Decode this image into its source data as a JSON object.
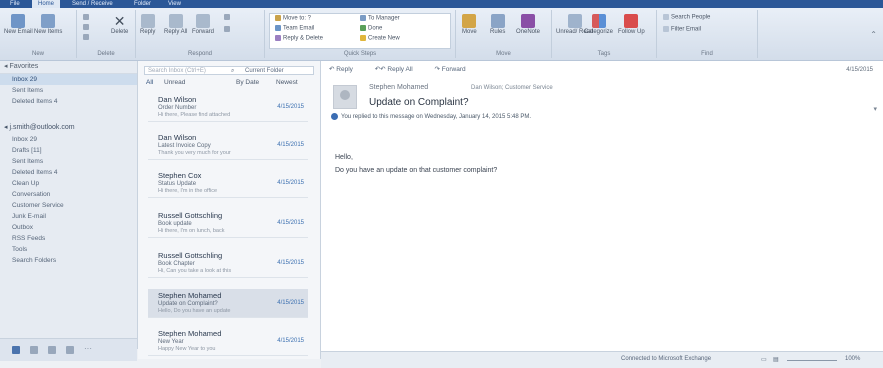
{
  "ribbon": {
    "groups": {
      "new_label": "New",
      "delete_label": "Delete",
      "respond_label": "Respond",
      "quick_steps_label": "Quick Steps",
      "move_label": "Move",
      "tags_label": "Tags",
      "find_label": "Find"
    },
    "buttons": {
      "new_email": "New Email",
      "new_items": "New Items",
      "delete": "Delete",
      "reply": "Reply",
      "reply_all": "Reply All",
      "forward": "Forward",
      "move": "Move",
      "rules": "Rules",
      "onenote": "OneNote",
      "unread_read": "Unread/ Read",
      "categorize": "Categorize",
      "follow_up": "Follow Up",
      "search_people": "Search People",
      "filter_email": "Filter Email"
    },
    "quick_steps": [
      "Move to: ?",
      "Team Email",
      "Reply & Delete",
      "To Manager",
      "Done",
      "Create New"
    ]
  },
  "nav": {
    "favorites_header": "Favorites",
    "favorites": [
      "Inbox 29",
      "Sent Items",
      "Deleted Items 4"
    ],
    "account": "j.smith@outlook.com",
    "folders": [
      "Inbox 29",
      "Drafts [11]",
      "Sent Items",
      "Deleted Items 4",
      "Clean Up",
      "Conversation",
      "Customer Service",
      "Junk E-mail",
      "Outbox",
      "RSS Feeds",
      "Tools",
      "Search Folders"
    ]
  },
  "message_list": {
    "search_placeholder": "Search Inbox (Ctrl+E)",
    "scope": "Current Folder",
    "filter_all": "All",
    "filter_unread": "Unread",
    "sort": "By Date",
    "order": "Newest",
    "messages": [
      {
        "sender": "Dan Wilson",
        "subject": "Order Number",
        "preview": "Hi there, Please find attached",
        "date": "4/15/2015"
      },
      {
        "sender": "Dan Wilson",
        "subject": "Latest Invoice Copy",
        "preview": "Thank you very much for your",
        "date": "4/15/2015"
      },
      {
        "sender": "Stephen Cox",
        "subject": "Status Update",
        "preview": "Hi there, I'm in the office",
        "date": "4/15/2015"
      },
      {
        "sender": "Russell Gottschling",
        "subject": "Book update",
        "preview": "Hi there, I'm on lunch, back",
        "date": "4/15/2015"
      },
      {
        "sender": "Russell Gottschling",
        "subject": "Book Chapter",
        "preview": "Hi, Can you take a look at this",
        "date": "4/15/2015"
      },
      {
        "sender": "Stephen Mohamed",
        "subject": "Update on Complaint?",
        "preview": "Hello, Do you have an update",
        "date": "4/15/2015"
      },
      {
        "sender": "Stephen Mohamed",
        "subject": "New Year",
        "preview": "Happy New Year to you",
        "date": "4/15/2015"
      }
    ]
  },
  "reading": {
    "toolbar": {
      "reply": "Reply",
      "reply_all": "Reply All",
      "forward": "Forward"
    },
    "date": "4/15/2015",
    "from": "Stephen Mohamed",
    "to": "Dan Wilson; Customer Service",
    "subject": "Update on Complaint?",
    "info": "You replied to this message on Wednesday, January 14, 2015 5:48 PM.",
    "body_greeting": "Hello,",
    "body_line": "Do you have an update on that customer complaint?"
  },
  "status": {
    "connection": "Connected to Microsoft Exchange",
    "zoom": "100%"
  }
}
